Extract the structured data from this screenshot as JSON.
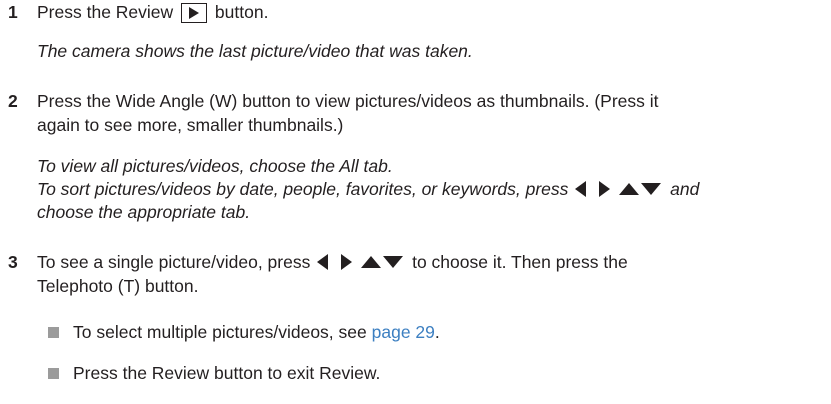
{
  "steps": [
    {
      "number": "1",
      "text_before": "Press the Review",
      "text_after": "button.",
      "note": "The camera shows the last picture/video that was taken."
    },
    {
      "number": "2",
      "line1": "Press the Wide Angle (W) button to view pictures/videos as thumbnails. (Press it",
      "line2": "again to see more, smaller thumbnails.)",
      "note1": "To view all pictures/videos, choose the All tab.",
      "note2_before": "To sort pictures/videos by date, people, favorites, or keywords, press",
      "note2_after": "and",
      "note3": "choose the appropriate tab."
    },
    {
      "number": "3",
      "line1_before": "To see a single picture/video, press",
      "line1_after": "to choose it. Then press the",
      "line2": "Telephoto (T) button."
    }
  ],
  "bullets": [
    {
      "text_before": "To select multiple pictures/videos, see",
      "link": "page 29",
      "text_after": "."
    },
    {
      "text": "Press the Review button to exit Review."
    }
  ],
  "icons": {
    "review": "play-triangle-icon",
    "navigation": "left-right-up-down-arrows-icon"
  },
  "colors": {
    "text": "#231f20",
    "link": "#3c7fc1",
    "bullet": "#9b9b9b"
  }
}
